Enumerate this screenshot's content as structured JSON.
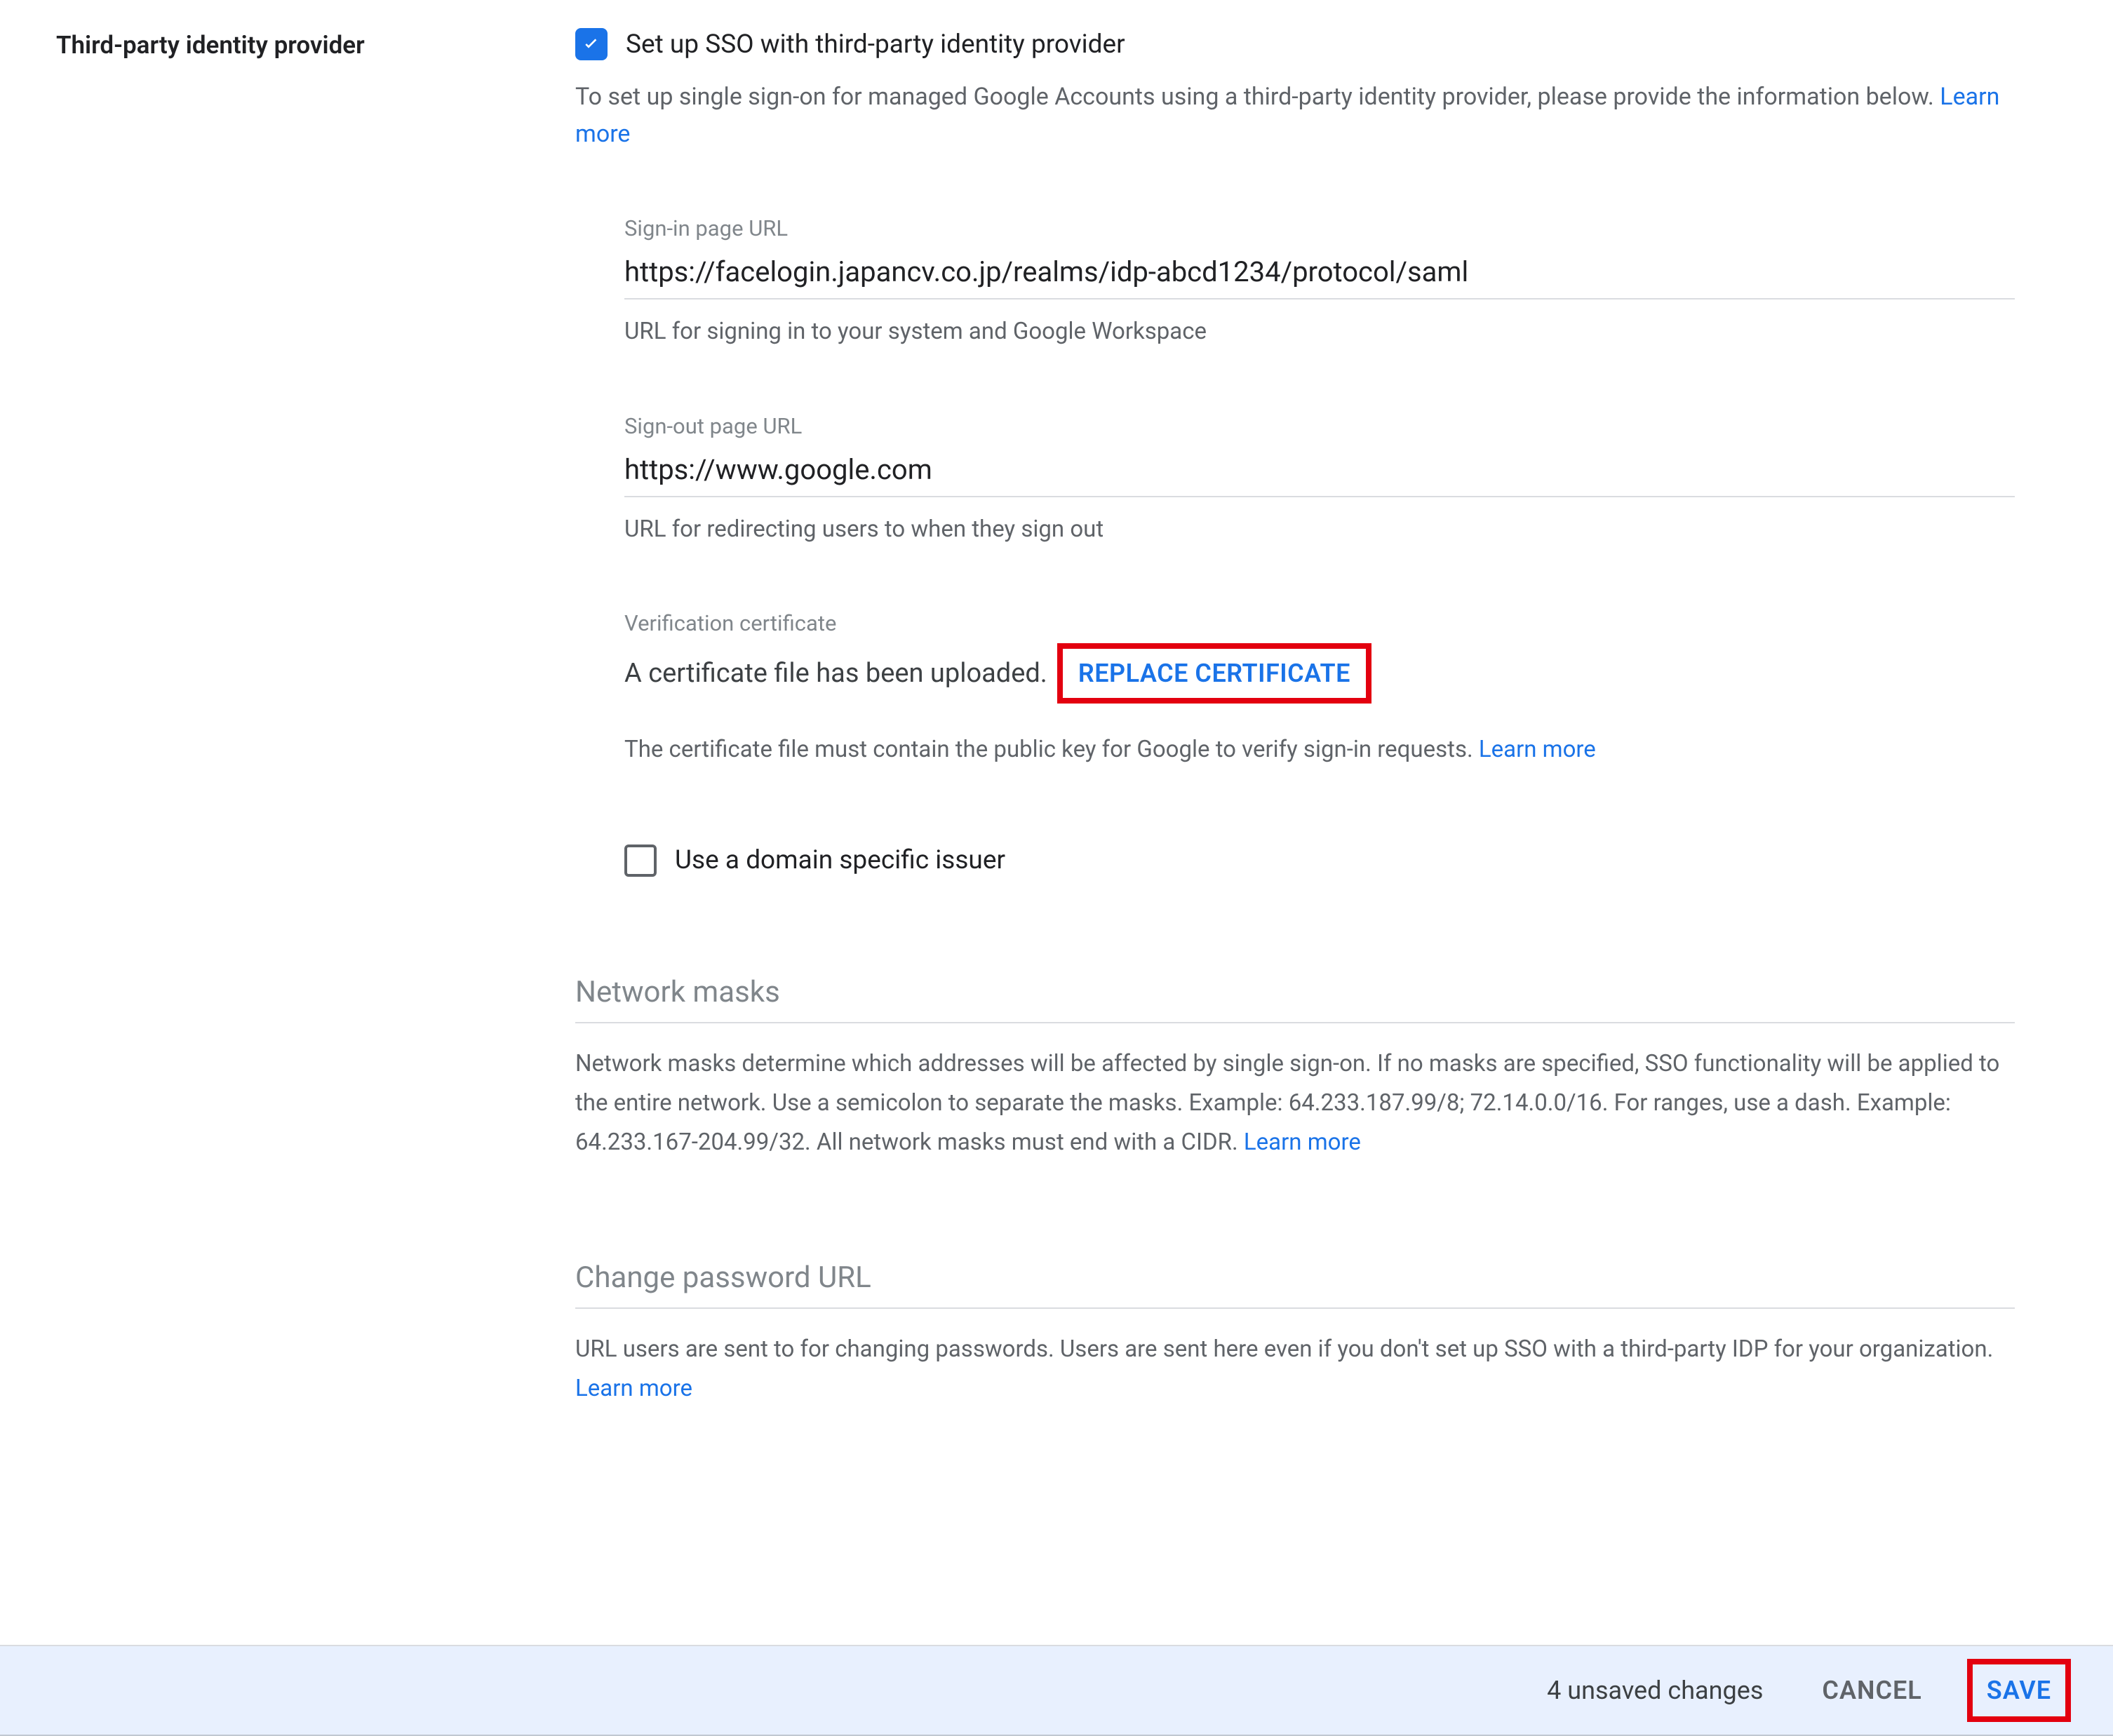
{
  "section": {
    "title": "Third-party identity provider"
  },
  "sso_checkbox": {
    "label": "Set up SSO with third-party identity provider",
    "checked": true
  },
  "sso_description": {
    "text": "To set up single sign-on for managed Google Accounts using a third-party identity provider, please provide the information below. ",
    "learn_more": "Learn more"
  },
  "signin": {
    "label": "Sign-in page URL",
    "value": "https://facelogin.japancv.co.jp/realms/idp-abcd1234/protocol/saml",
    "help": "URL for signing in to your system and Google Workspace"
  },
  "signout": {
    "label": "Sign-out page URL",
    "value": "https://www.google.com",
    "help": "URL for redirecting users to when they sign out"
  },
  "cert": {
    "label": "Verification certificate",
    "status": "A certificate file has been uploaded.",
    "replace_btn": "REPLACE CERTIFICATE",
    "help": "The certificate file must contain the public key for Google to verify sign-in requests. ",
    "learn_more": "Learn more"
  },
  "domain_issuer": {
    "label": "Use a domain specific issuer",
    "checked": false
  },
  "network_masks": {
    "heading": "Network masks",
    "desc": "Network masks determine which addresses will be affected by single sign-on. If no masks are specified, SSO functionality will be applied to the entire network. Use a semicolon to separate the masks. Example: 64.233.187.99/8; 72.14.0.0/16. For ranges, use a dash. Example: 64.233.167-204.99/32. All network masks must end with a CIDR. ",
    "learn_more": "Learn more"
  },
  "change_password": {
    "heading": "Change password URL",
    "desc": "URL users are sent to for changing passwords. Users are sent here even if you don't set up SSO with a third-party IDP for your organization. ",
    "learn_more": "Learn more"
  },
  "footer": {
    "unsaved": "4 unsaved changes",
    "cancel": "CANCEL",
    "save": "SAVE"
  }
}
